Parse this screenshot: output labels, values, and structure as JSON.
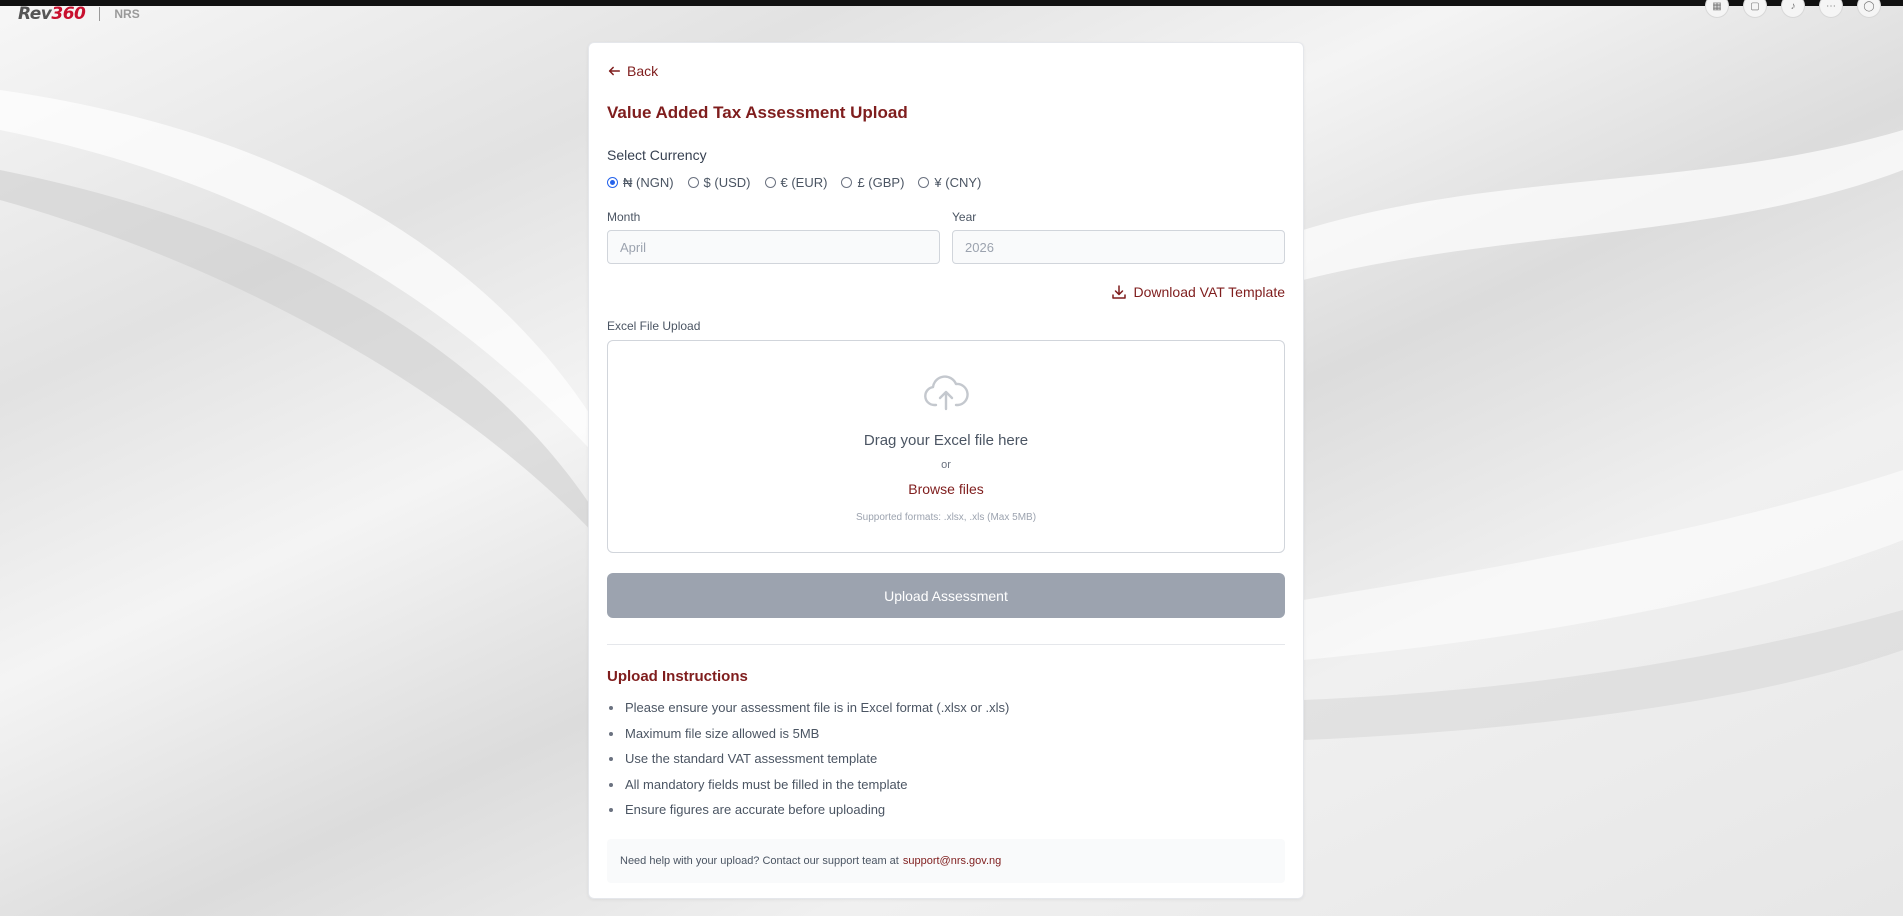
{
  "header": {
    "logo_text_a": "Rev",
    "logo_text_b": "360",
    "logo_secondary": "NRS"
  },
  "page": {
    "back_label": "Back",
    "title": "Value Added Tax Assessment Upload"
  },
  "currency": {
    "label": "Select Currency",
    "options": [
      "₦ (NGN)",
      "$ (USD)",
      "€ (EUR)",
      "£ (GBP)",
      "¥ (CNY)"
    ],
    "selected": "₦ (NGN)"
  },
  "period": {
    "month_label": "Month",
    "month_value": "April",
    "year_label": "Year",
    "year_value": "2026"
  },
  "download": {
    "label": "Download VAT Template"
  },
  "upload": {
    "label": "Excel File Upload",
    "drag_text": "Drag your Excel file here",
    "or_text": "or",
    "browse_label": "Browse files",
    "formats_text": "Supported formats: .xlsx, .xls (Max 5MB)",
    "button_label": "Upload Assessment"
  },
  "instructions": {
    "title": "Upload Instructions",
    "items": [
      "Please ensure your assessment file is in Excel format (.xlsx or .xls)",
      "Maximum file size allowed is 5MB",
      "Use the standard VAT assessment template",
      "All mandatory fields must be filled in the template",
      "Ensure figures are accurate before uploading"
    ]
  },
  "help": {
    "text": "Need help with your upload? Contact our support team at",
    "email": "support@nrs.gov.ng"
  },
  "colors": {
    "accent": "#7f1d1d",
    "button_disabled": "#9ca3af",
    "radio_selected": "#2563eb"
  }
}
